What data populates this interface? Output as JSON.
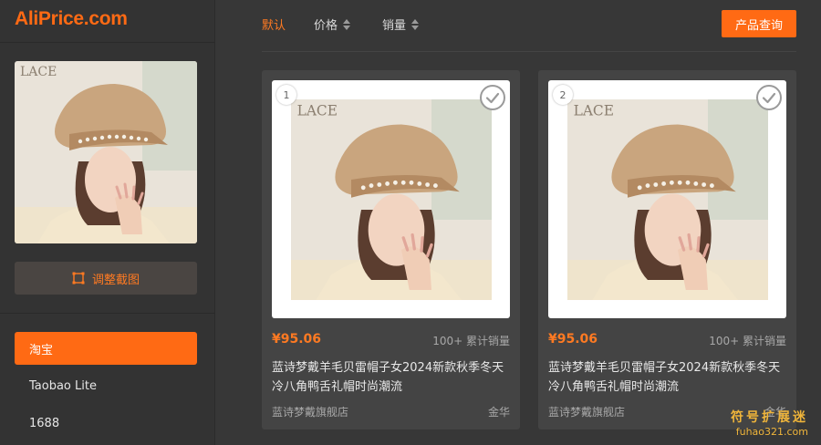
{
  "app": {
    "logo": "AliPrice.com"
  },
  "sidebar": {
    "crop_button_label": "调整截图",
    "platforms": [
      {
        "label": "淘宝",
        "active": true
      },
      {
        "label": "Taobao Lite",
        "active": false
      },
      {
        "label": "1688",
        "active": false
      }
    ]
  },
  "toolbar": {
    "sort_default": "默认",
    "sort_price": "价格",
    "sort_sales": "销量",
    "query_button": "产品查询"
  },
  "products": [
    {
      "index": "1",
      "price": "¥95.06",
      "sales": "100+ 累计销量",
      "title": "蓝诗梦戴羊毛贝雷帽子女2024新款秋季冬天冷八角鸭舌礼帽时尚潮流",
      "shop": "蓝诗梦戴旗舰店",
      "location": "金华"
    },
    {
      "index": "2",
      "price": "¥95.06",
      "sales": "100+ 累计销量",
      "title": "蓝诗梦戴羊毛贝雷帽子女2024新款秋季冬天冷八角鸭舌礼帽时尚潮流",
      "shop": "蓝诗梦戴旗舰店",
      "location": "金华"
    }
  ],
  "watermark": {
    "line1": "符号扩展迷",
    "line2": "fuhao321.com"
  },
  "colors": {
    "accent": "#ff6a14",
    "background": "#373737",
    "card": "#444444"
  }
}
